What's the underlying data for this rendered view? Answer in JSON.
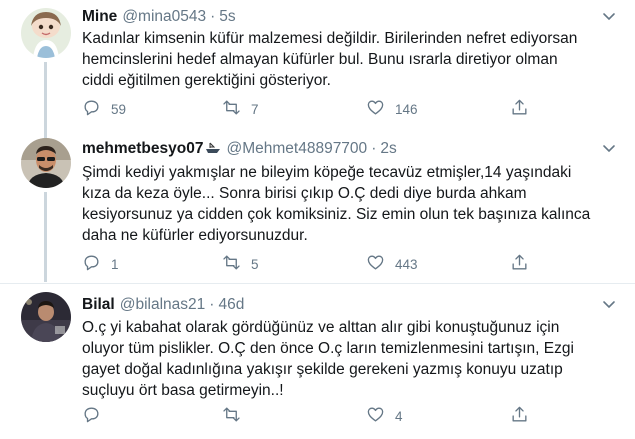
{
  "tweets": [
    {
      "name": "Mine",
      "handle": "@mina0543",
      "time": "5s",
      "lines": [
        "Kadınlar kimsenin küfür malzemesi değildir. Birilerinden nefret ediyorsan",
        "hemcinslerini hedef almayan küfürler bul.  Bunu  ısrarla diretiyor olman",
        "ciddi eğitilmen gerektiğini gösteriyor."
      ],
      "replies": "59",
      "retweets": "7",
      "likes": "146"
    },
    {
      "name": "mehmetbesyo07",
      "handle": "@Mehmet48897700",
      "time": "2s",
      "lines": [
        "Şimdi kediyi yakmışlar ne bileyim köpeğe tecavüz etmişler,14 yaşındaki",
        "kıza da keza öyle... Sonra birisi çıkıp O.Ç dedi diye burda ahkam",
        "kesiyorsunuz ya cidden çok komiksiniz. Siz emin olun tek başınıza kalınca",
        "daha ne küfürler ediyorsunuzdur."
      ],
      "replies": "1",
      "retweets": "5",
      "likes": "443"
    },
    {
      "name": "Bilal",
      "handle": "@bilalnas21",
      "time": "46d",
      "lines": [
        "O.ç yi kabahat olarak gördüğünüz ve alttan alır gibi konuştuğunuz için",
        "oluyor tüm pislikler. O.Ç den önce O.ç ların temizlenmesini tartışın, Ezgi",
        "gayet doğal kadınlığına yakışır şekilde gerekeni yazmış konuyu uzatıp",
        "suçluyu ört basa getirmeyin..!"
      ],
      "replies": "",
      "retweets": "",
      "likes": "4"
    }
  ],
  "icons": {
    "reply": "reply-icon",
    "retweet": "retweet-icon",
    "like": "heart-icon",
    "share": "share-icon",
    "caret": "chevron-down-icon"
  },
  "colors": {
    "text": "#14171a",
    "secondary": "#657786",
    "thread_line": "#ccd6dd",
    "divider": "#e6ecf0"
  }
}
